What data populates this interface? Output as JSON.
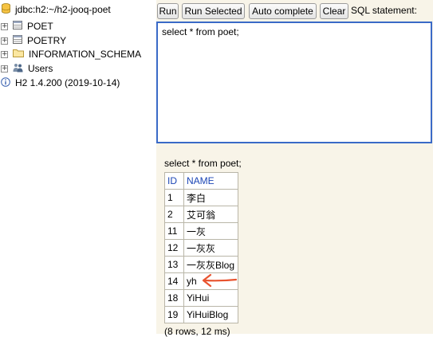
{
  "tree": {
    "connection": "jdbc:h2:~/h2-jooq-poet",
    "items": [
      {
        "label": "POET",
        "icon": "table-icon"
      },
      {
        "label": "POETRY",
        "icon": "table-icon"
      },
      {
        "label": "INFORMATION_SCHEMA",
        "icon": "folder-icon"
      },
      {
        "label": "Users",
        "icon": "users-icon"
      }
    ],
    "version": "H2 1.4.200 (2019-10-14)"
  },
  "toolbar": {
    "run": "Run",
    "run_selected": "Run Selected",
    "auto_complete": "Auto complete",
    "clear": "Clear",
    "sql_label": "SQL statement:"
  },
  "editor": {
    "value": "select * from poet;"
  },
  "result": {
    "query": "select * from poet;",
    "columns": [
      "ID",
      "NAME"
    ],
    "rows": [
      [
        "1",
        "李白"
      ],
      [
        "2",
        "艾可翁"
      ],
      [
        "11",
        "一灰"
      ],
      [
        "12",
        "一灰灰"
      ],
      [
        "13",
        "一灰灰Blog"
      ],
      [
        "14",
        "yh"
      ],
      [
        "18",
        "YiHui"
      ],
      [
        "19",
        "YiHuiBlog"
      ]
    ],
    "footer": "(8 rows, 12 ms)"
  },
  "colors": {
    "panel_bg": "#f8f4e8",
    "editor_border": "#3a6ac7",
    "header_text": "#1c46b5",
    "arrow": "#e8532f"
  }
}
